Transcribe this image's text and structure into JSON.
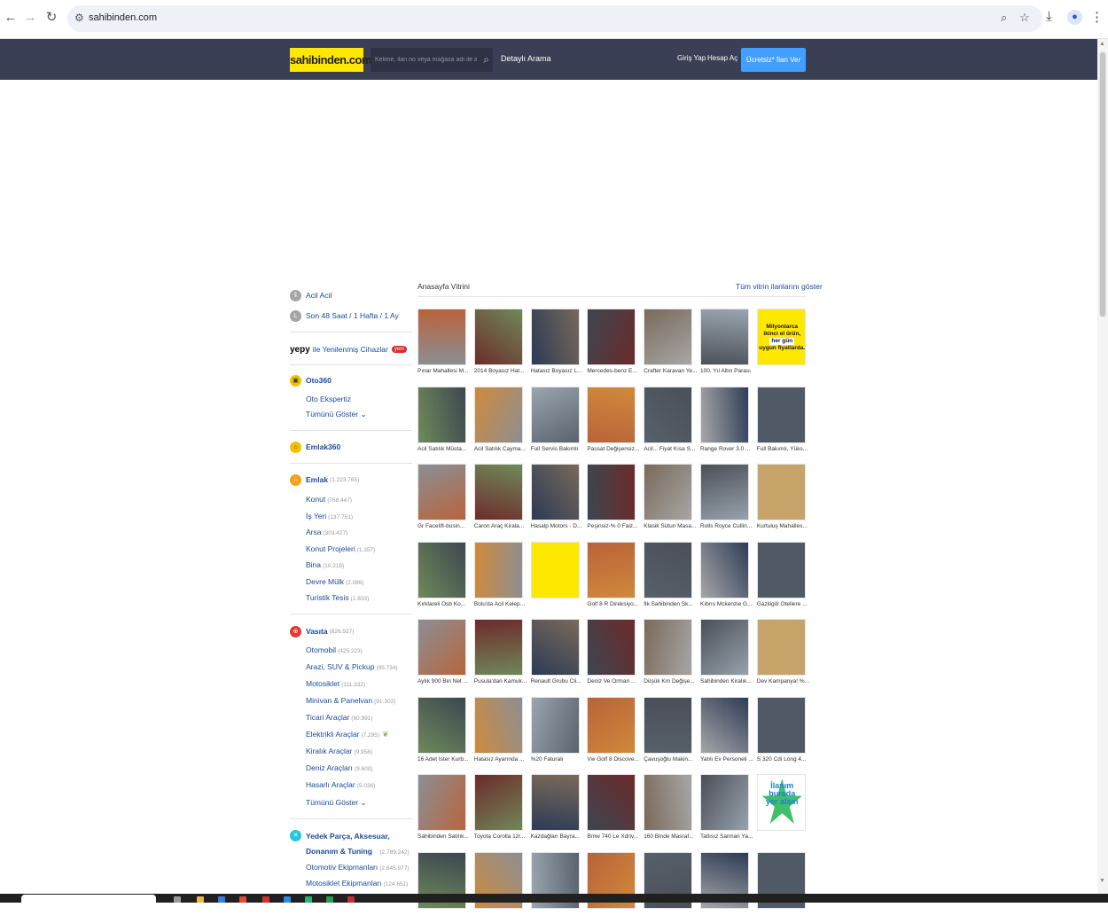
{
  "browser": {
    "url": "sahibinden.com",
    "icons": [
      "back-icon",
      "forward-icon",
      "reload-icon",
      "site-settings-icon",
      "zoom-icon",
      "bookmark-star-icon",
      "download-icon",
      "profile-icon",
      "menu-icon"
    ]
  },
  "header": {
    "logo": "sahibinden.com",
    "search_placeholder": "Kelime, ilan no veya mağaza adı ile ara",
    "advanced_search": "Detaylı Arama",
    "login": "Giriş Yap",
    "register": "Hesap Aç",
    "cta": "Ücretsiz* İlan Ver",
    "colors": {
      "bar": "#3a3f55",
      "logo": "#ffe800",
      "cta": "#41a0ff"
    }
  },
  "sidebar": {
    "urgent": "Acil Acil",
    "recent": "Son 48 Saat / 1 Hafta / 1 Ay",
    "yepy_logo": "yepy",
    "yepy_text": "ile Yenilenmiş Cihazlar",
    "yepy_badge": "yeni",
    "oto360": "Oto360",
    "oto_expert": "Oto Ekspertiz",
    "show_all": "Tümünü Göster",
    "emlak360": "Emlak360",
    "emlak": {
      "label": "Emlak",
      "count": "(1.223.765)"
    },
    "emlak_items": [
      {
        "label": "Konut",
        "count": "(768.447)"
      },
      {
        "label": "İş Yeri",
        "count": "(137.751)"
      },
      {
        "label": "Arsa",
        "count": "(303.427)"
      },
      {
        "label": "Konut Projeleri",
        "count": "(1.357)"
      },
      {
        "label": "Bina",
        "count": "(10.218)"
      },
      {
        "label": "Devre Mülk",
        "count": "(2.086)"
      },
      {
        "label": "Turistik Tesis",
        "count": "(1.833)"
      }
    ],
    "vasita": {
      "label": "Vasıta",
      "count": "(826.927)"
    },
    "vasita_items": [
      {
        "label": "Otomobil",
        "count": "(425.223)"
      },
      {
        "label": "Arazi, SUV & Pickup",
        "count": "(95.734)"
      },
      {
        "label": "Motosiklet",
        "count": "(111.332)"
      },
      {
        "label": "Minivan & Panelvan",
        "count": "(91.302)"
      },
      {
        "label": "Ticari Araçlar",
        "count": "(60.991)"
      },
      {
        "label": "Elektrikli Araçlar",
        "count": "(7.295)"
      },
      {
        "label": "Kiralık Araçlar",
        "count": "(9.958)"
      },
      {
        "label": "Deniz Araçları",
        "count": "(9.600)"
      },
      {
        "label": "Hasarlı Araçlar",
        "count": "(5.036)"
      }
    ],
    "vasita_show_all": "Tümünü Göster",
    "yedek": {
      "label_line1": "Yedek Parça, Aksesuar,",
      "label_line2": "Donanım & Tuning",
      "count": "(2.789.242)"
    },
    "yedek_items": [
      {
        "label": "Otomotiv Ekipmanları",
        "count": "(2.645.977)"
      },
      {
        "label": "Motosiklet Ekipmanları",
        "count": "(124.651)"
      }
    ]
  },
  "showcase": {
    "title": "Anasayfa Vitrini",
    "show_all": "Tüm vitrin ilanlarını göster",
    "ad_text": [
      "Milyonlarca",
      "ikinci el ürün,",
      "her gün",
      "uygun fiyatlarda."
    ],
    "promo_text": [
      "İlanım",
      "burada",
      "yer alsın"
    ],
    "captions": [
      "Pınar Mahallesi M...",
      "2014 Boyasız Hat...",
      "Hatasız Boyasız L...",
      "Mercedes-benz E...",
      "Crafter Karavan Ye...",
      "100. Yıl Altın Parası",
      "",
      "Acil Satılık Müsta...",
      "Acil Satılık Cayma...",
      "Full Servis Bakımlı",
      "Passat Değişensiz...",
      "Acil... Fiyat Kısa S...",
      "Range Rover 3.0 ...",
      "Full Bakımlı, Yüks...",
      "Gr Facelift-busin...",
      "Caron Araç Kirala...",
      "Hasalp Motors - D...",
      "Peşinsiz-% 0 Faiz...",
      "Klasik Sütun Masa...",
      "Rolls Royce Cullin...",
      "Kurtuluş Mahalles...",
      "Kırklareli Osb Ko...",
      "Bolu'da Acil Kelep...",
      "",
      "Golf 8 R Direksiyo...",
      "İlk Sahibinden Sk...",
      "Kıbrıs Mckenzie G...",
      "Gaziligöl Otellere ...",
      "Aylık 900 Bin Net ...",
      "Pusula'dan Kamuk...",
      "Renault Grubu Cli...",
      "Deniz Ve Orman ...",
      "Düşük Km Değişe...",
      "Sahibinden Kiralık...",
      "Dev Kampanya! %...",
      "16 Adet İster Kurb...",
      "Hatasız Ayarında ...",
      "%20 Faturalı",
      "Vw Golf 8 Discove...",
      "Çavuşoğlu Makin...",
      "Yatılı Ev Personeli ...",
      "S 320 Cdi Long 4...",
      "Sahibinden Satılık...",
      "Toyota Corolla 1zr...",
      "Kazdağları Bayra...",
      "Bmw 740 Le Xdriv...",
      "160 Binde Masraf...",
      "Tatlısız Sarman Ya...",
      ""
    ]
  }
}
